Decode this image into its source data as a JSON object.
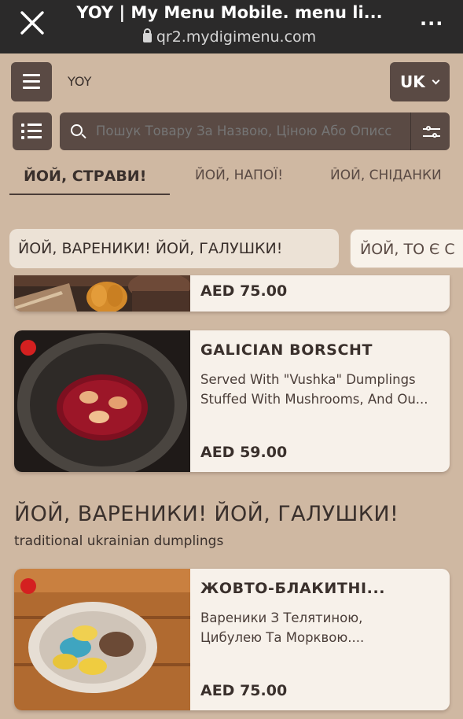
{
  "browser": {
    "title": "YOY | My Menu Mobile. menu li...",
    "url": "qr2.mydigimenu.com",
    "more_label": "..."
  },
  "header": {
    "brand": "YOY",
    "language": "UK"
  },
  "search": {
    "placeholder": "Пошук Товару За Назвою, Ціною Або Описс"
  },
  "tabs": [
    {
      "label": "ЙОЙ, СТРАВИ!",
      "active": true
    },
    {
      "label": "ЙОЙ, НАПОЇ!",
      "active": false
    },
    {
      "label": "ЙОЙ, СНІДАНКИ",
      "active": false
    }
  ],
  "chips": [
    {
      "label": "ЙОЙ, ВАРЕНИКИ! ЙОЙ, ГАЛУШКИ!",
      "active": true
    },
    {
      "label": "ЙОЙ, ТО Є С",
      "active": false
    }
  ],
  "items": [
    {
      "name": "",
      "description": [],
      "price": "AED 75.00"
    },
    {
      "name": "GALICIAN BORSCHT",
      "description": [
        "Served With \"Vushka\" Dumplings",
        "Stuffed With Mushrooms, And Ou..."
      ],
      "price": "AED 59.00"
    },
    {
      "name": "ЖОВТО-БЛАКИТНІ...",
      "description": [
        "Вареники З Телятиною,",
        "Цибулею Та Морквою...."
      ],
      "price": "AED 75.00"
    }
  ],
  "section": {
    "title": "ЙОЙ, ВАРЕНИКИ! ЙОЙ, ГАЛУШКИ!",
    "subtitle": "traditional ukrainian dumplings"
  },
  "colors": {
    "background": "#cfb8a2",
    "dark_button": "#5a4a44",
    "card": "#f7f1ea",
    "badge": "#d42020"
  }
}
